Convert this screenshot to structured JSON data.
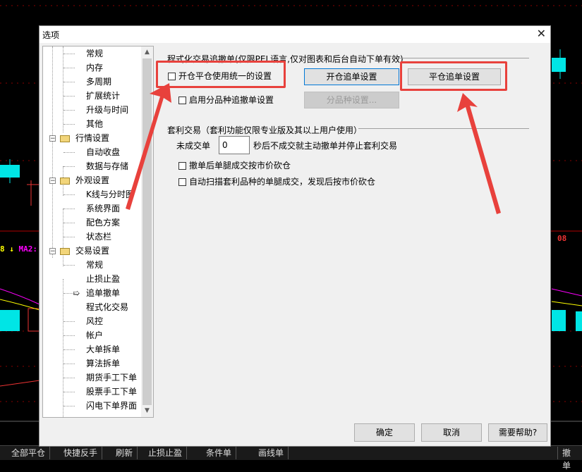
{
  "dialog": {
    "title": "选项",
    "close_glyph": "✕"
  },
  "tree": {
    "items": [
      {
        "label": "常规",
        "level": 1
      },
      {
        "label": "内存",
        "level": 1
      },
      {
        "label": "多周期",
        "level": 1
      },
      {
        "label": "扩展统计",
        "level": 1
      },
      {
        "label": "升级与时间",
        "level": 1
      },
      {
        "label": "其他",
        "level": 1
      },
      {
        "label": "行情设置",
        "level": 0
      },
      {
        "label": "自动收盘",
        "level": 1
      },
      {
        "label": "数据与存储",
        "level": 1
      },
      {
        "label": "外观设置",
        "level": 0
      },
      {
        "label": "K线与分时图",
        "level": 1
      },
      {
        "label": "系统界面",
        "level": 1
      },
      {
        "label": "配色方案",
        "level": 1
      },
      {
        "label": "状态栏",
        "level": 1
      },
      {
        "label": "交易设置",
        "level": 0
      },
      {
        "label": "常规",
        "level": 1
      },
      {
        "label": "止损止盈",
        "level": 1
      },
      {
        "label": "追单撤单",
        "level": 1,
        "selected": true
      },
      {
        "label": "程式化交易",
        "level": 1
      },
      {
        "label": "风控",
        "level": 1
      },
      {
        "label": "帐户",
        "level": 1
      },
      {
        "label": "大单拆单",
        "level": 1
      },
      {
        "label": "算法拆单",
        "level": 1
      },
      {
        "label": "期货手工下单",
        "level": 1
      },
      {
        "label": "股票手工下单",
        "level": 1
      },
      {
        "label": "闪电下单界面",
        "level": 1
      }
    ],
    "expander_glyph": "−",
    "selected_arrow": "➯"
  },
  "section1": {
    "header": "程式化交易追撤单(仅限PEL语言,仅对图表和后台自动下单有效)",
    "unified_checkbox": {
      "label": "开仓平仓使用统一的设置",
      "checked": false
    },
    "per_product_checkbox": {
      "label": "启用分品种追撤单设置",
      "checked": false
    },
    "open_button": "开仓追单设置",
    "close_button": "平仓追单设置",
    "per_product_button": "分品种设置..."
  },
  "section2": {
    "header": "套利交易（套利功能仅限专业版及其以上用户使用）",
    "unfilled_label": "未成交单",
    "unfilled_value": "0",
    "unfilled_suffix": "秒后不成交就主动撤单并停止套利交易",
    "cancel_leg_checkbox": {
      "label": "撤单后单腿成交按市价砍仓",
      "checked": false
    },
    "scan_checkbox": {
      "label": "自动扫描套利品种的单腿成交，发现后按市价砍仓",
      "checked": false
    }
  },
  "footer": {
    "ok": "确定",
    "cancel": "取消",
    "help": "需要帮助?"
  },
  "taskbar": {
    "buttons": [
      "全部平仓",
      "快捷反手",
      "刷新",
      "止损止盈",
      "条件单",
      "画线单"
    ],
    "right_button": "撤单"
  },
  "chart": {
    "ma_label_value": "8",
    "ma_label_arrow": "↓",
    "ma_label_name": "MA2:",
    "right_price": "08",
    "colors": {
      "candle": "#00e5e5",
      "ma_yellow": "#ffff00",
      "ma_magenta": "#ff00ff",
      "grid_red": "#b00000"
    }
  },
  "colors": {
    "highlight": "#e8413c",
    "focus": "#0078d7"
  }
}
